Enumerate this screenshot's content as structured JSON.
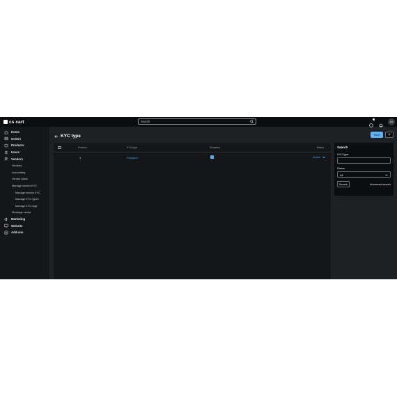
{
  "app": {
    "logo_text": "cs cart"
  },
  "topbar": {
    "search_placeholder": "Search",
    "avatar_initials": "AA"
  },
  "sidebar": {
    "items": [
      {
        "label": "Home",
        "icon": "home-icon"
      },
      {
        "label": "Orders",
        "icon": "orders-icon"
      },
      {
        "label": "Products",
        "icon": "products-icon"
      },
      {
        "label": "Users",
        "icon": "users-icon"
      },
      {
        "label": "Vendors",
        "icon": "vendors-icon"
      }
    ],
    "vendor_sub": [
      "Vendors",
      "Accounting",
      "Vendor plans",
      "Manage vendor KYC"
    ],
    "kyc_sub": [
      "Manage vendor KYC",
      "Manage KYC types",
      "Manage KYC logs"
    ],
    "after_sub": "Message center",
    "bottom_items": [
      {
        "label": "Marketing",
        "icon": "marketing-icon"
      },
      {
        "label": "Website",
        "icon": "website-icon"
      },
      {
        "label": "Add-ons",
        "icon": "addons-icon"
      }
    ]
  },
  "page": {
    "title": "KYC type",
    "save_label": "Save",
    "add_label": "+"
  },
  "table": {
    "headers": {
      "position": "Position",
      "kyc_type": "KYC type",
      "required": "Required",
      "status": "Status"
    },
    "rows": [
      {
        "position": "1",
        "kyc_type": "Passport",
        "required": true,
        "status": "Active"
      }
    ]
  },
  "search_panel": {
    "title": "Search",
    "kyc_type_label": "KYC type",
    "kyc_type_value": "",
    "status_label": "Status",
    "status_value": "All",
    "search_button": "Search",
    "advanced_link": "Advanced search"
  },
  "colors": {
    "accent": "#4aa3ee",
    "save_button": "#62b1f5",
    "app_bg": "#1e2124",
    "topbar_bg": "#0c0d0f"
  }
}
